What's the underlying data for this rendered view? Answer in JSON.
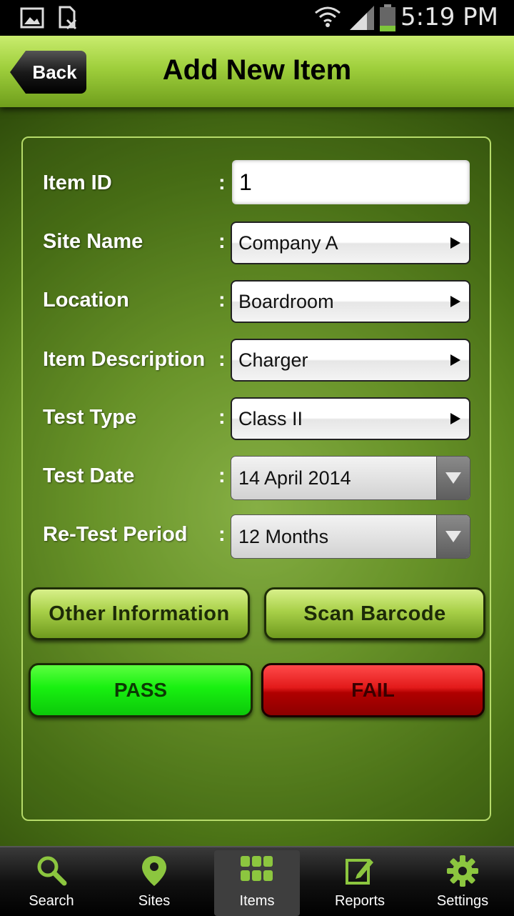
{
  "status_bar": {
    "time": "5:19 PM"
  },
  "header": {
    "back_label": "Back",
    "title": "Add New Item"
  },
  "form": {
    "item_id": {
      "label": "Item ID",
      "value": "1"
    },
    "site_name": {
      "label": "Site Name",
      "value": "Company A"
    },
    "location": {
      "label": "Location",
      "value": "Boardroom"
    },
    "item_description": {
      "label": "Item Description",
      "value": "Charger"
    },
    "test_type": {
      "label": "Test Type",
      "value": "Class II"
    },
    "test_date": {
      "label": "Test Date",
      "value": "14 April 2014"
    },
    "retest_period": {
      "label": "Re-Test Period",
      "value": "12 Months"
    },
    "colon": ":"
  },
  "buttons": {
    "other_information": "Other Information",
    "scan_barcode": "Scan Barcode",
    "pass": "PASS",
    "fail": "FAIL"
  },
  "nav": {
    "items": [
      {
        "label": "Search",
        "icon": "search-icon"
      },
      {
        "label": "Sites",
        "icon": "map-pin-icon"
      },
      {
        "label": "Items",
        "icon": "grid-icon",
        "active": true
      },
      {
        "label": "Reports",
        "icon": "edit-icon"
      },
      {
        "label": "Settings",
        "icon": "gear-icon"
      }
    ]
  },
  "colors": {
    "accent_green": "#9fcf3c",
    "pass_green": "#18f010",
    "fail_red": "#e21a1a",
    "icon_green": "#8cc63f"
  }
}
